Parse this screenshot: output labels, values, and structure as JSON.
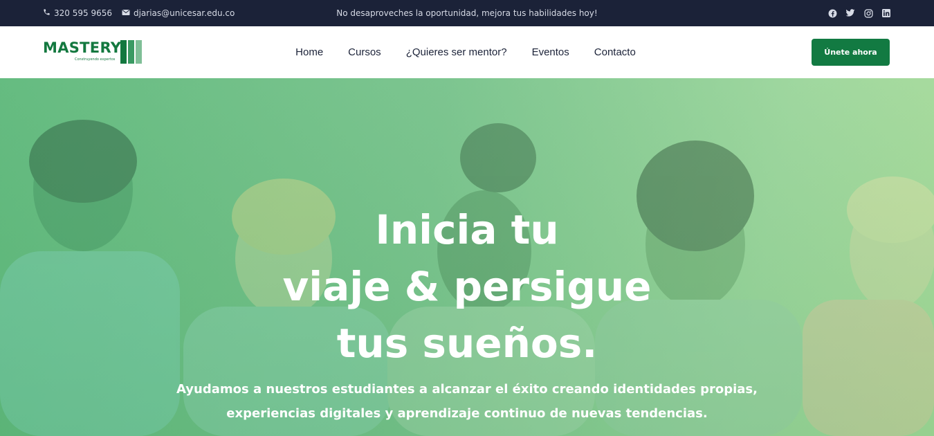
{
  "topbar": {
    "phone": "320 595 9656",
    "email": "djarias@unicesar.edu.co",
    "promo": "No desaproveches la oportunidad, mejora tus habilidades hoy!",
    "social": [
      "facebook-icon",
      "twitter-icon",
      "instagram-icon",
      "linkedin-icon"
    ]
  },
  "header": {
    "logo_text": "MASTERY",
    "logo_tagline": "Construyendo expertos",
    "nav": [
      "Home",
      "Cursos",
      "¿Quieres ser mentor?",
      "Eventos",
      "Contacto"
    ],
    "cta_label": "Únete ahora"
  },
  "hero": {
    "title_line1": "Inicia tu",
    "title_line2": "viaje & persigue",
    "title_line3": "tus sueños.",
    "subtitle_line1": "Ayudamos a nuestros estudiantes a alcanzar el éxito creando identidades propias,",
    "subtitle_line2": "experiencias digitales y aprendizaje continuo de nuevas tendencias."
  },
  "colors": {
    "topbar_bg": "#1b2238",
    "brand_green": "#13783f",
    "cta_bg": "#127a42",
    "hero_overlay": "#76c28a"
  }
}
